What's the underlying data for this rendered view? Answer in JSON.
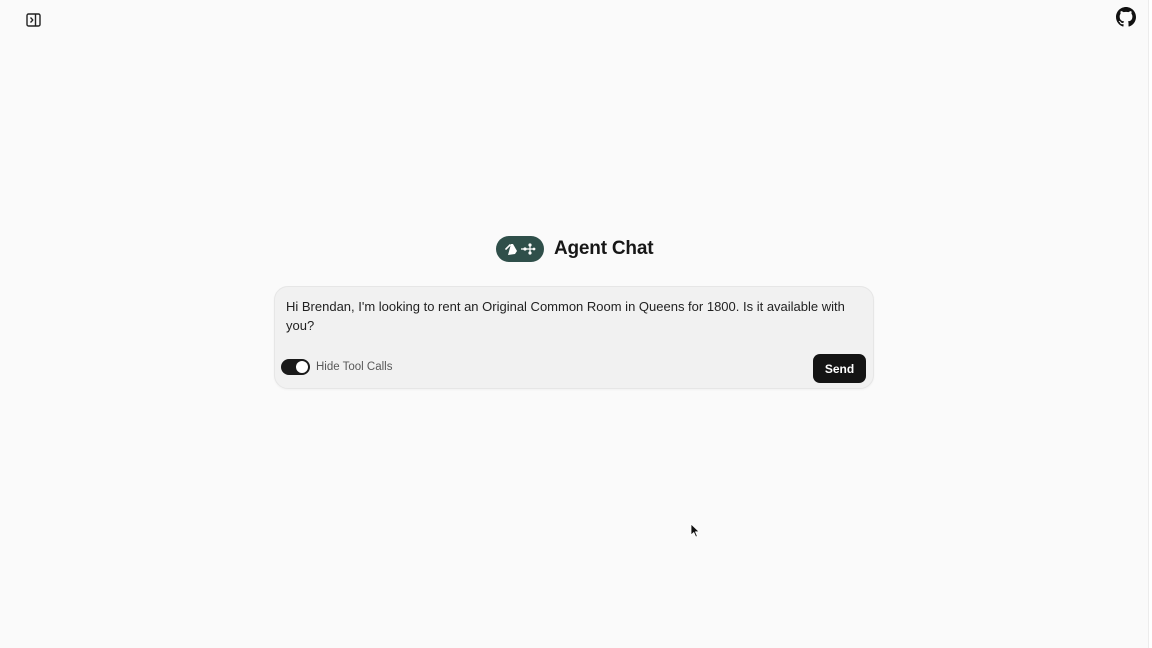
{
  "header": {
    "sidebar_toggle_icon": "panel-right-open-icon",
    "github_icon": "github-icon"
  },
  "brand": {
    "logo_icon": "langgraph-logo-icon",
    "logo_color": "#2f4f4a",
    "title": "Agent Chat"
  },
  "composer": {
    "message": "Hi Brendan, I'm looking to rent an Original Common Room in Queens for 1800. Is it available with you?",
    "toggle_label": "Hide Tool Calls",
    "toggle_on": true,
    "send_label": "Send"
  },
  "colors": {
    "background": "#fafafa",
    "send_button": "#141414",
    "toggle_on": "#1a1a1a"
  }
}
